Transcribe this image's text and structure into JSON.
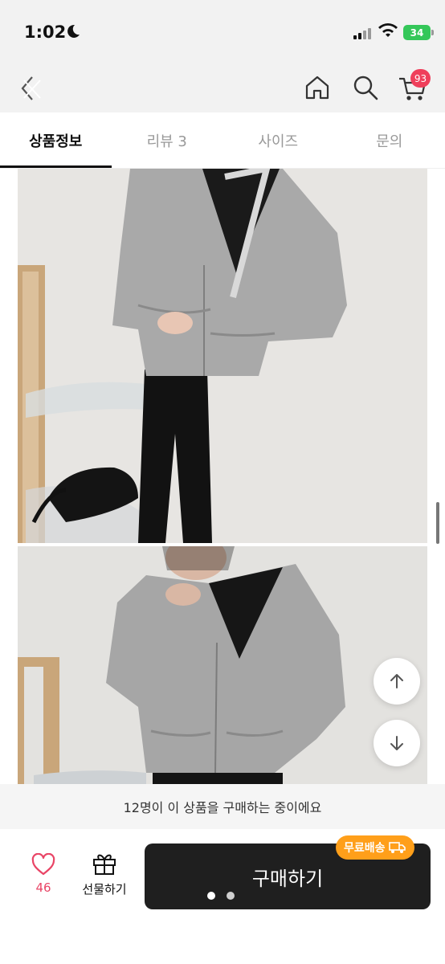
{
  "status_bar": {
    "time": "1:02",
    "battery": "34",
    "battery_color": "#34c759"
  },
  "nav": {
    "back_icon": "close-back-icon",
    "home_icon": "home-icon",
    "search_icon": "search-icon",
    "cart_icon": "cart-icon",
    "cart_badge": "93"
  },
  "tabs": [
    {
      "label": "상품정보",
      "active": true
    },
    {
      "label": "리뷰 3",
      "active": false
    },
    {
      "label": "사이즈",
      "active": false
    },
    {
      "label": "문의",
      "active": false
    }
  ],
  "content": {
    "photos": [
      {
        "subject": "gray-cropped-hoodie-zip-up-full-body"
      },
      {
        "subject": "gray-cropped-hoodie-zip-up-upper-body"
      }
    ]
  },
  "scroll_buttons": {
    "up_icon": "arrow-up-icon",
    "down_icon": "arrow-down-icon"
  },
  "notice": {
    "text": "12명이 이 상품을 구매하는 중이에요"
  },
  "actions": {
    "like_icon": "heart-icon",
    "like_count": "46",
    "gift_icon": "gift-icon",
    "gift_label": "선물하기",
    "buy_label": "구매하기",
    "shipping_badge": "무료배송",
    "shipping_icon": "truck-icon",
    "accent_color": "#ef3f5b",
    "badge_color": "#ff9f1a"
  },
  "pagination": {
    "pages": 2,
    "current": 1
  }
}
